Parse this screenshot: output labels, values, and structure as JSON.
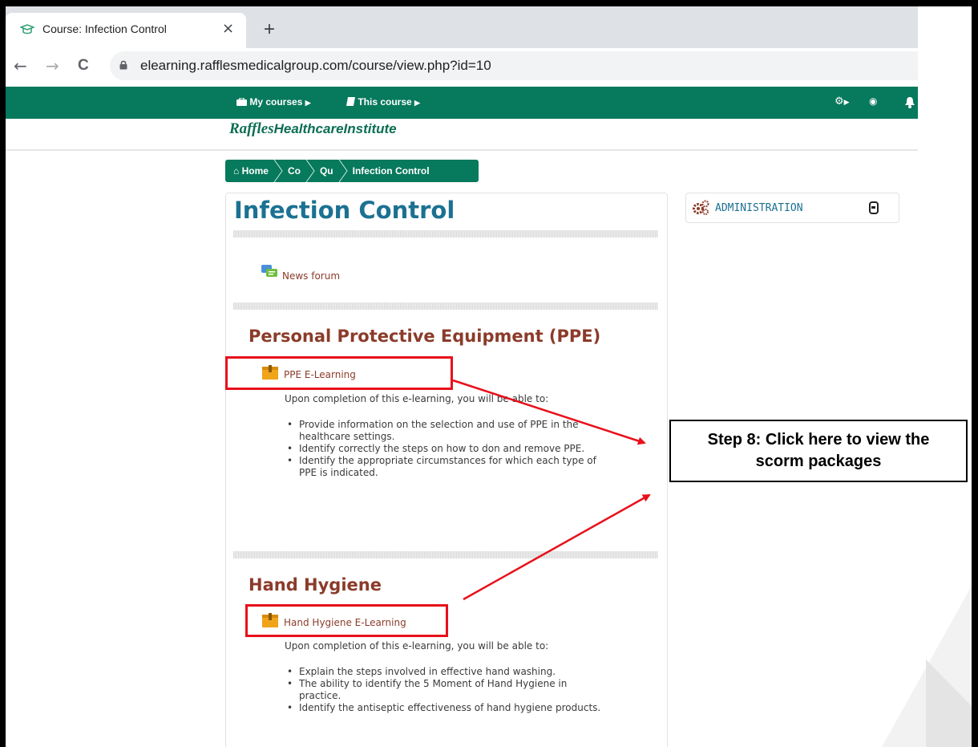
{
  "browser": {
    "tab_title": "Course: Infection Control",
    "tab_close": "×",
    "new_tab": "+",
    "back": "←",
    "forward": "→",
    "reload": "C",
    "url": "elearning.rafflesmedicalgroup.com/course/view.php?id=10"
  },
  "navbar": {
    "my_courses": "My courses",
    "this_course": "This course",
    "brand_prefix": "Raffles",
    "brand_suffix": "HealthcareInstitute"
  },
  "breadcrumb": [
    "Home",
    "Co",
    "Qu",
    "Infection Control"
  ],
  "course": {
    "title": "Infection Control",
    "news_forum": "News forum",
    "sections": [
      {
        "title": "Personal Protective Equipment (PPE)",
        "activity": "PPE E-Learning",
        "intro": "Upon completion of this e-learning, you will be able to:",
        "bullets": [
          "Provide information on the selection and use of PPE in the healthcare settings.",
          "Identify correctly the steps on how to don and remove PPE.",
          "Identify the appropriate circumstances for which each type of PPE is indicated."
        ]
      },
      {
        "title": "Hand Hygiene",
        "activity": "Hand Hygiene E-Learning",
        "intro": "Upon completion of this e-learning, you will be able to:",
        "bullets": [
          "Explain the steps involved in effective hand washing.",
          "The ability to identify the 5 Moment of Hand Hygiene in practice.",
          "Identify the antiseptic effectiveness of hand hygiene products."
        ]
      }
    ]
  },
  "admin": {
    "label": "ADMINISTRATION"
  },
  "annotation": {
    "line1": "Step 8: Click here to view the",
    "line2": "scorm packages",
    "color": "#e8101a"
  },
  "colors": {
    "nav_green": "#07795d",
    "title_blue": "#1b7192",
    "section_brown": "#8b3b2a"
  }
}
